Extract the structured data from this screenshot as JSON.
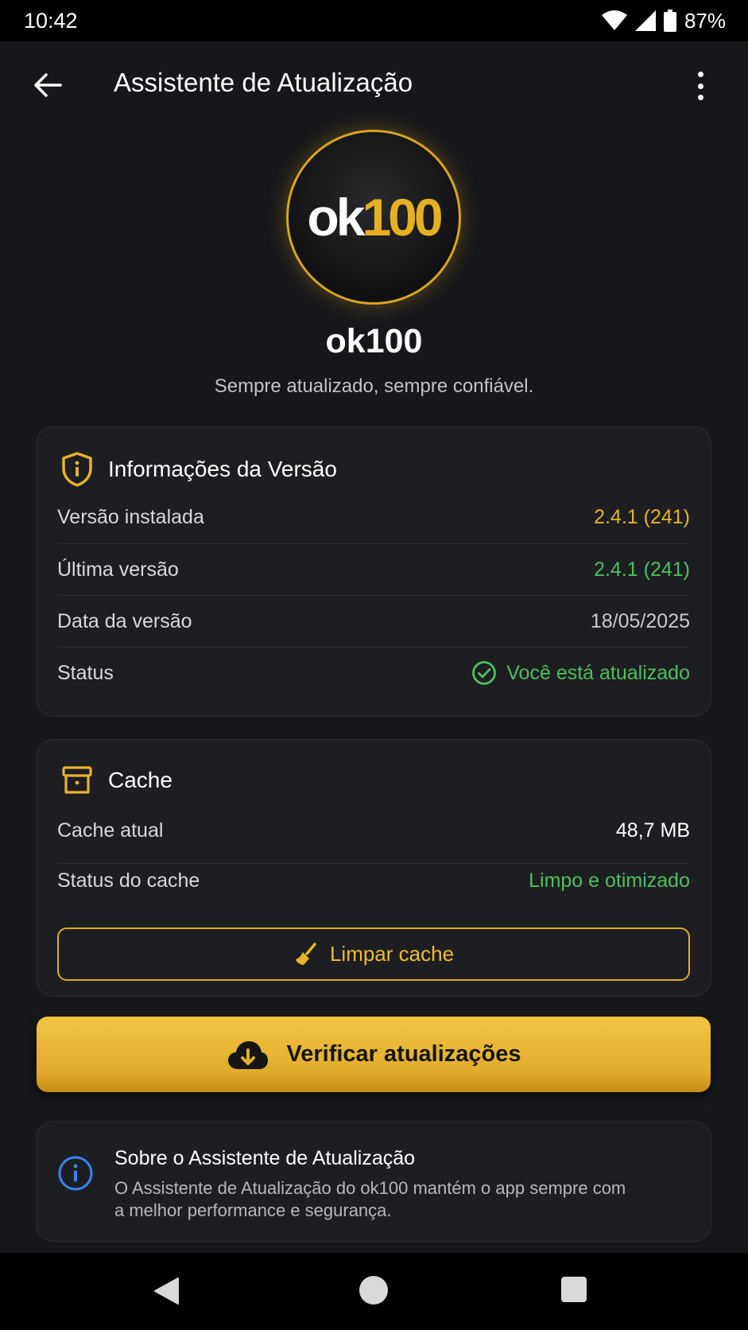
{
  "status_bar": {
    "time": "10:42",
    "battery": "87%"
  },
  "app_bar": {
    "title": "Assistente de Atualização"
  },
  "logo": {
    "part_white": "ok",
    "part_gold": "100"
  },
  "brand": {
    "name": "ok100",
    "tagline": "Sempre atualizado, sempre confiável."
  },
  "version_card": {
    "title": "Informações da Versão",
    "rows": [
      {
        "label": "Versão instalada",
        "value": "2.4.1 (241)"
      },
      {
        "label": "Última versão",
        "value": "2.4.1 (241)"
      },
      {
        "label": "Data da versão",
        "value": "18/05/2025"
      },
      {
        "label": "Status",
        "value": "Você está atualizado"
      }
    ]
  },
  "cache_card": {
    "title": "Cache",
    "rows": [
      {
        "label": "Cache atual",
        "value": "48,7 MB"
      },
      {
        "label": "Status do cache",
        "value": "Limpo e otimizado"
      }
    ],
    "clear_button": "Limpar cache"
  },
  "check_button": "Verificar atualizações",
  "about_card": {
    "title": "Sobre o Assistente de Atualização",
    "text": "O Assistente de Atualização do ok100 mantém o app sempre com a melhor performance e segurança."
  },
  "colors": {
    "accent": "#e8b22a",
    "success": "#4cc15a",
    "background": "#16171b",
    "card": "#1d1e22",
    "info": "#3b82f6"
  }
}
